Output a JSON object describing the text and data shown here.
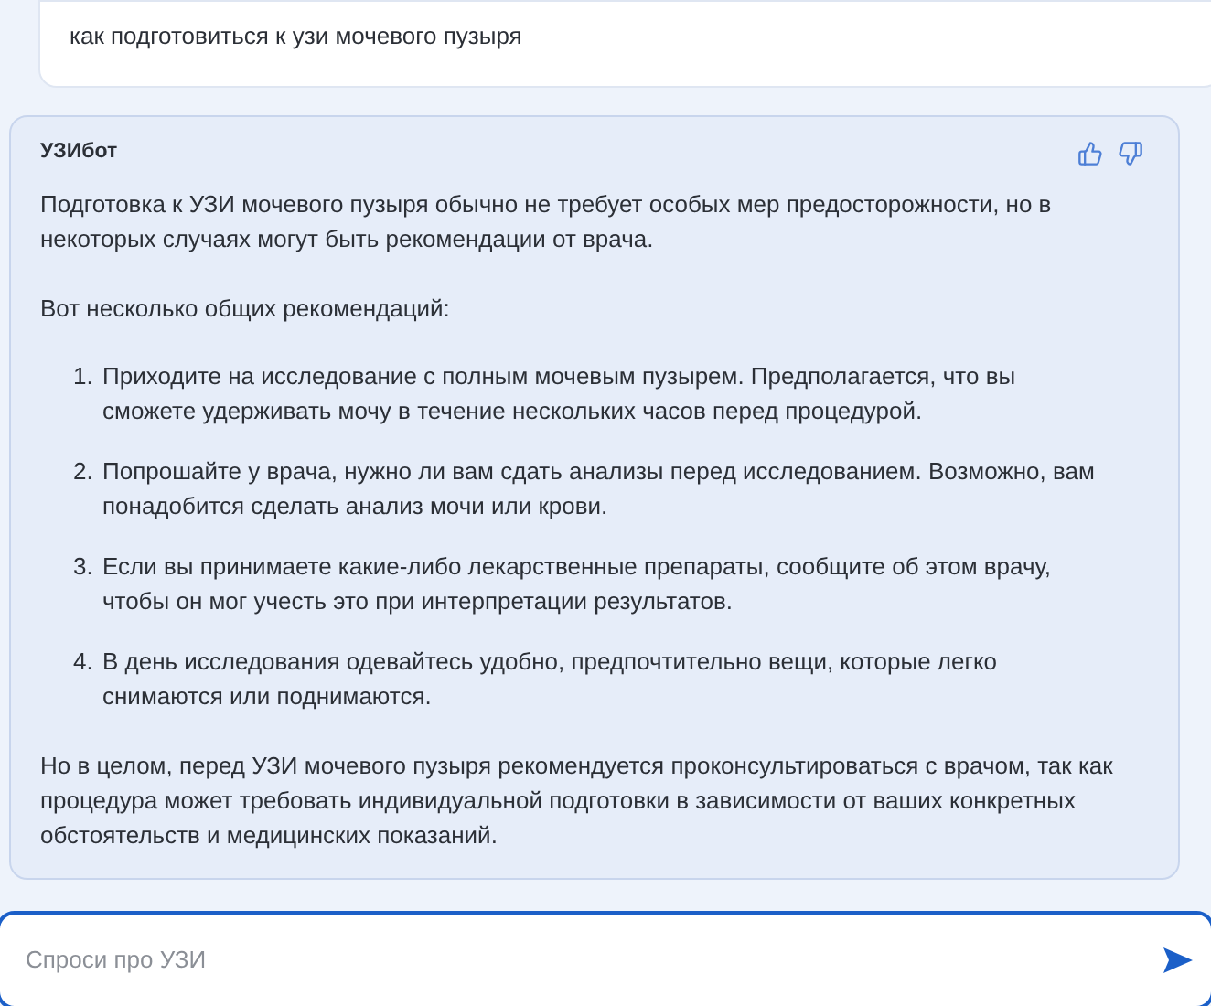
{
  "user_message": "как подготовиться к узи мочевого пузыря",
  "bot_message": {
    "author": "УЗИбот",
    "intro": "Подготовка к УЗИ мочевого пузыря обычно не требует особых мер предосторожности, но в некоторых случаях могут быть рекомендации от врача.",
    "lead": "Вот несколько общих рекомендаций:",
    "items": [
      {
        "number": "1.",
        "text": "Приходите на исследование с полным мочевым пузырем. Предполагается, что вы сможете удерживать мочу в течение нескольких часов перед процедурой."
      },
      {
        "number": "2.",
        "text": "Попрошайте у врача, нужно ли вам сдать анализы перед исследованием. Возможно, вам понадобится сделать анализ мочи или крови."
      },
      {
        "number": "3.",
        "text": "Если вы принимаете какие-либо лекарственные препараты, сообщите об этом врачу, чтобы он мог учесть это при интерпретации результатов."
      },
      {
        "number": "4.",
        "text": "В день исследования одевайтесь удобно, предпочтительно вещи, которые легко снимаются или поднимаются."
      }
    ],
    "conclusion": "Но в целом, перед УЗИ мочевого пузыря рекомендуется проконсультироваться с врачом, так как процедура может требовать индивидуальной подготовки в зависимости от ваших конкретных обстоятельств и медицинских показаний."
  },
  "input": {
    "placeholder": "Спроси про УЗИ"
  }
}
